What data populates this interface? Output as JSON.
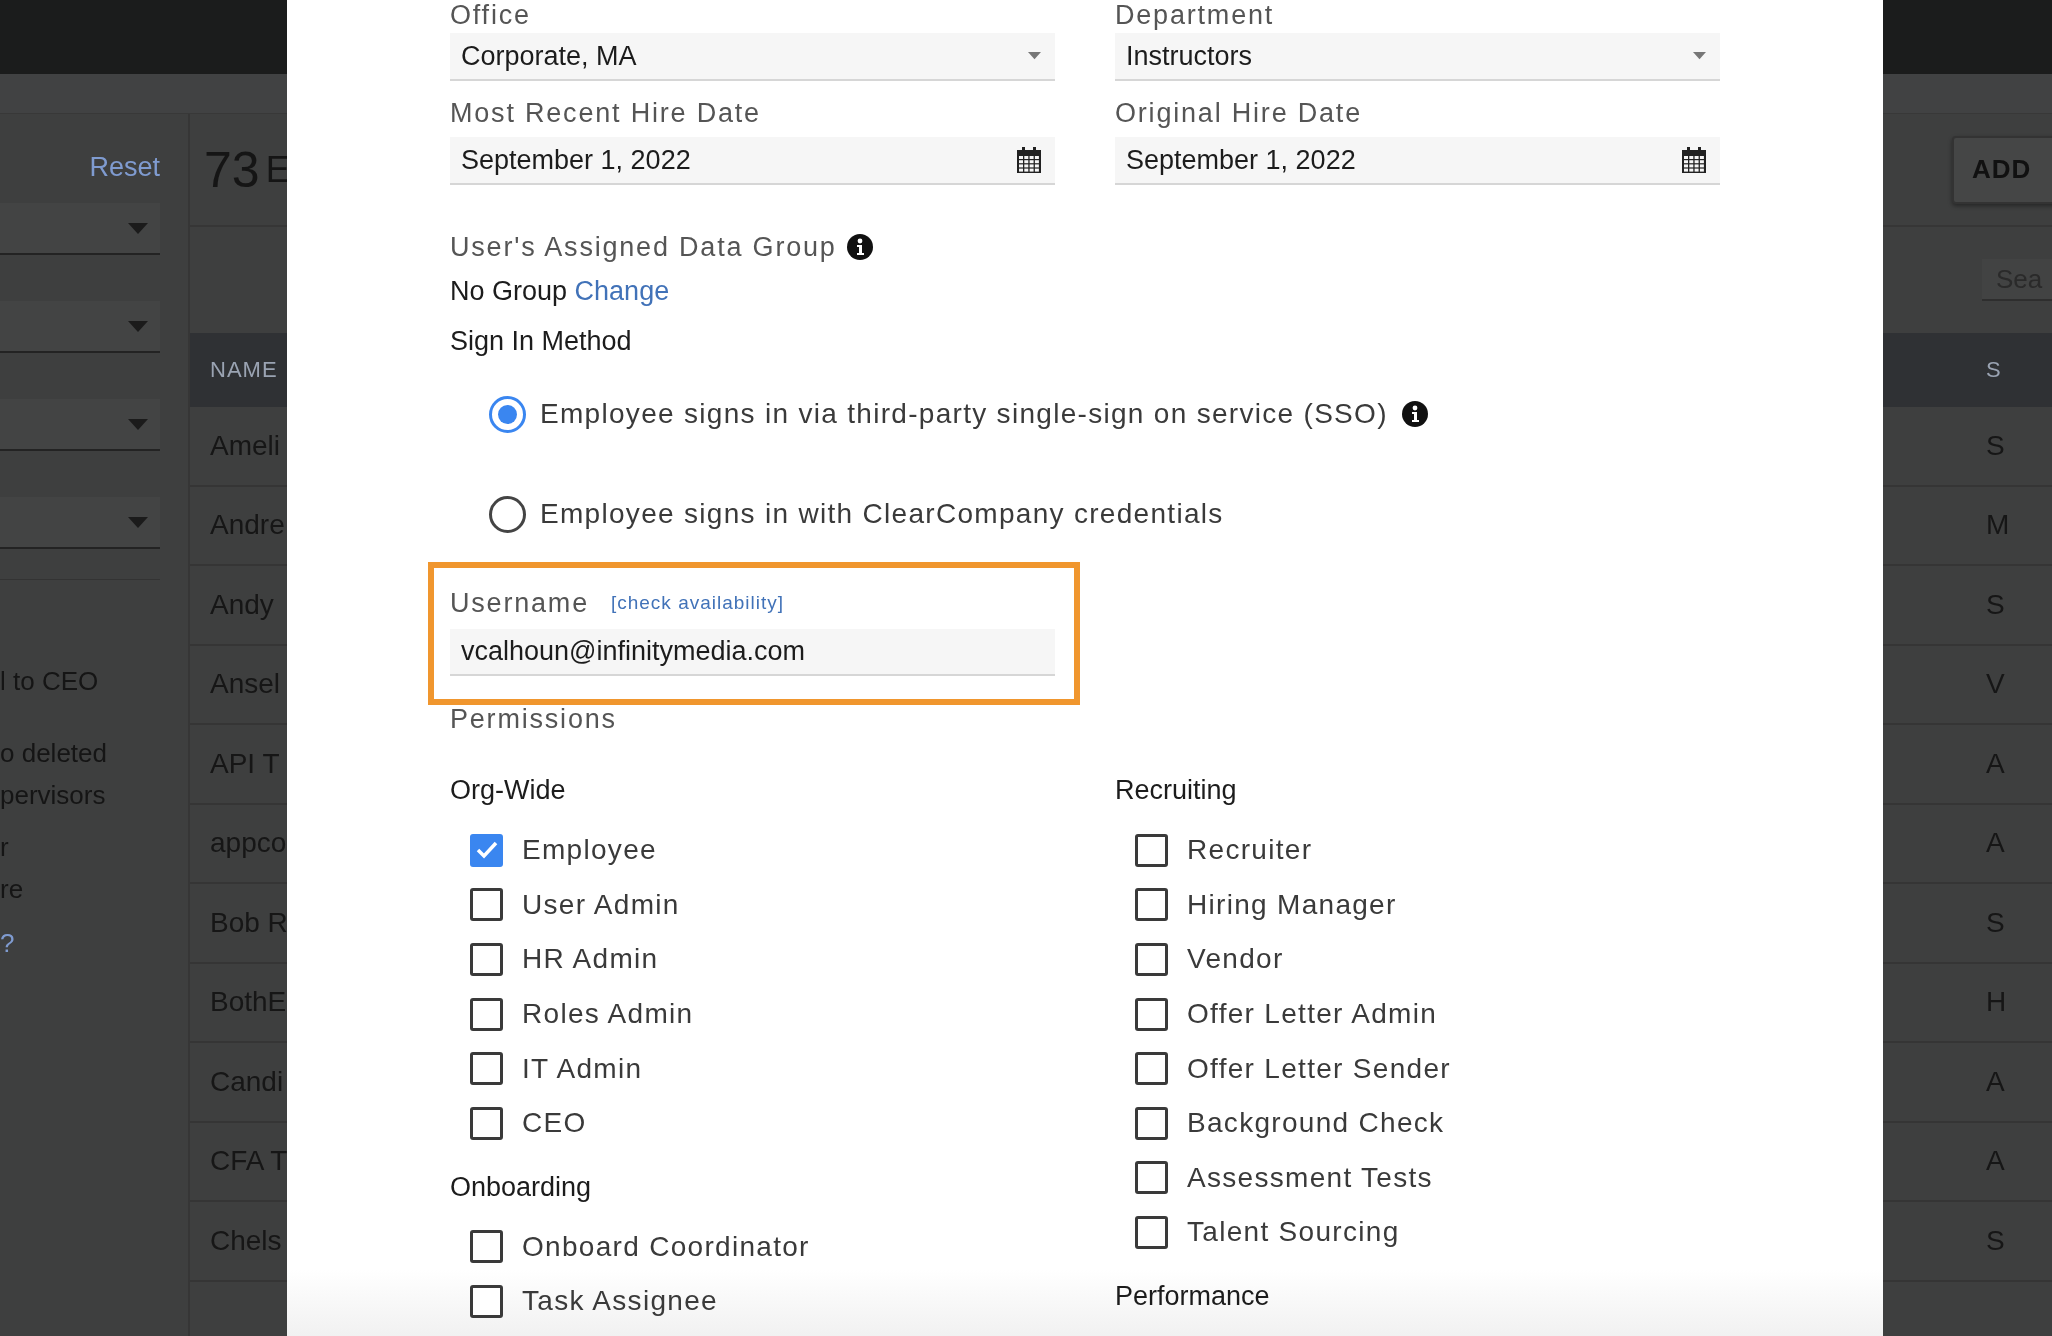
{
  "background": {
    "sidebar": {
      "reset_link": "Reset",
      "notes": [
        "l to CEO",
        "o deleted",
        "pervisors",
        "r",
        "re"
      ],
      "help_link": "?"
    },
    "count": "73",
    "count_label": "E",
    "add_button": "ADD",
    "search": {
      "placeholder": "Sea"
    },
    "table": {
      "columns": [
        "NAME",
        "S"
      ],
      "rows": [
        {
          "name": "Ameli",
          "column_2": "S"
        },
        {
          "name": "Andre",
          "column_2": "M"
        },
        {
          "name": "Andy",
          "column_2": "S"
        },
        {
          "name": "Ansel",
          "column_2": "V"
        },
        {
          "name": "API T",
          "column_2": "A"
        },
        {
          "name": "appco",
          "column_2": "A"
        },
        {
          "name": "Bob R",
          "column_2": "S"
        },
        {
          "name": "BothE",
          "column_2": "H"
        },
        {
          "name": "Candi",
          "column_2": "A"
        },
        {
          "name": "CFA T",
          "column_2": "A"
        },
        {
          "name": "Chels",
          "column_2": "S"
        }
      ]
    }
  },
  "modal": {
    "field_rows": [
      [
        {
          "label": "Office",
          "value": "Corporate, MA",
          "kind": "select"
        },
        {
          "label": "Department",
          "value": "Instructors",
          "kind": "select"
        }
      ],
      [
        {
          "label": "Most Recent Hire Date",
          "value": "September 1, 2022",
          "kind": "date"
        },
        {
          "label": "Original Hire Date",
          "value": "September 1, 2022",
          "kind": "date"
        }
      ]
    ],
    "data_group": {
      "label": "User's Assigned Data Group",
      "value": "No Group",
      "link": "Change"
    },
    "sign_in": {
      "label": "Sign In Method",
      "options": [
        {
          "label": "Employee signs in via third-party single-sign on service (SSO)",
          "selected": true,
          "info": true
        },
        {
          "label": "Employee signs in with ClearCompany credentials",
          "selected": false,
          "info": false
        }
      ]
    },
    "username": {
      "label": "Username",
      "link": "[check availability]",
      "value": "vcalhoun@infinitymedia.com",
      "highlighted": true
    },
    "permissions": {
      "title": "Permissions",
      "columns": [
        {
          "groups": [
            {
              "title": "Org-Wide",
              "items": [
                {
                  "label": "Employee",
                  "checked": true
                },
                {
                  "label": "User Admin",
                  "checked": false
                },
                {
                  "label": "HR Admin",
                  "checked": false
                },
                {
                  "label": "Roles Admin",
                  "checked": false
                },
                {
                  "label": "IT Admin",
                  "checked": false
                },
                {
                  "label": "CEO",
                  "checked": false
                }
              ]
            },
            {
              "title": "Onboarding",
              "items": [
                {
                  "label": "Onboard Coordinator",
                  "checked": false
                },
                {
                  "label": "Task Assignee",
                  "checked": false
                }
              ]
            }
          ]
        },
        {
          "groups": [
            {
              "title": "Recruiting",
              "items": [
                {
                  "label": "Recruiter",
                  "checked": false
                },
                {
                  "label": "Hiring Manager",
                  "checked": false
                },
                {
                  "label": "Vendor",
                  "checked": false
                },
                {
                  "label": "Offer Letter Admin",
                  "checked": false
                },
                {
                  "label": "Offer Letter Sender",
                  "checked": false
                },
                {
                  "label": "Background Check",
                  "checked": false
                },
                {
                  "label": "Assessment Tests",
                  "checked": false
                },
                {
                  "label": "Talent Sourcing",
                  "checked": false
                }
              ]
            },
            {
              "title": "Performance"
            }
          ]
        }
      ]
    }
  }
}
